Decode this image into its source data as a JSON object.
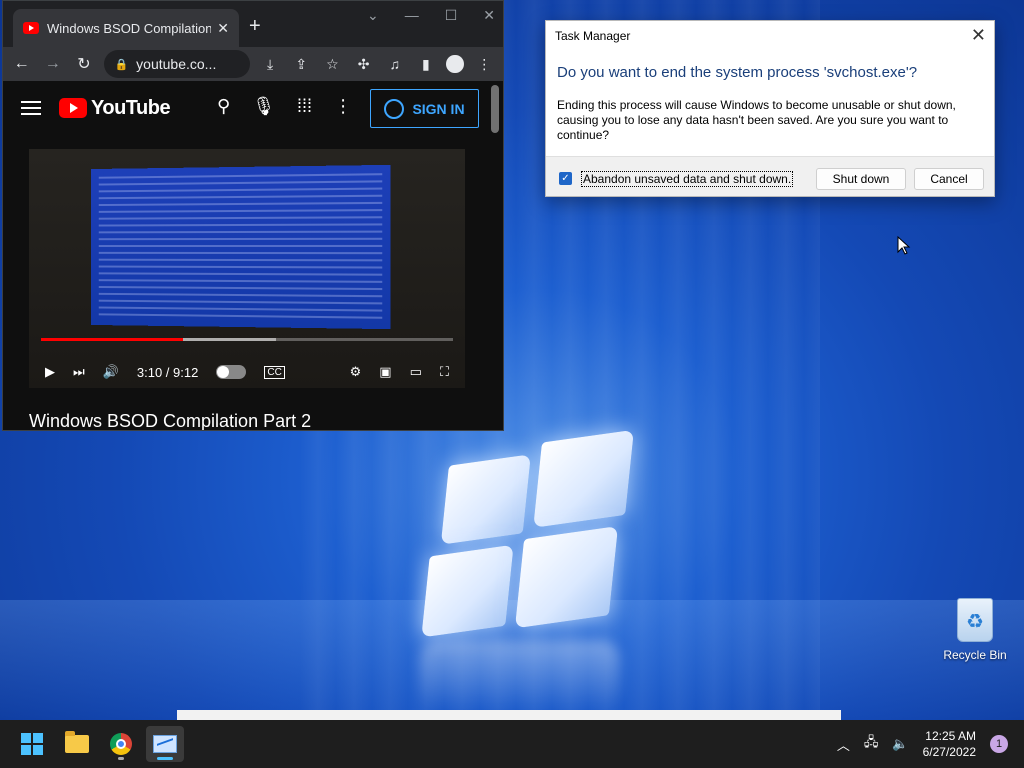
{
  "browser": {
    "tab_title": "Windows BSOD Compilation",
    "address": "youtube.co...",
    "window_controls": [
      "chevron-down-icon",
      "minimize-icon",
      "maximize-icon",
      "close-icon"
    ]
  },
  "youtube": {
    "logo_text": "YouTube",
    "sign_in_label": "SIGN IN",
    "video_time": "3:10 / 9:12",
    "video_title": "Windows BSOD Compilation Part 2",
    "progress_played_fraction": 0.345,
    "progress_buffered_fraction": 0.57
  },
  "dialog": {
    "title": "Task Manager",
    "heading": "Do you want to end the system process 'svchost.exe'?",
    "body": "Ending this process will cause Windows to become unusable or shut down, causing you to lose any data hasn't been saved. Are you sure you want to continue?",
    "checkbox_label": "Abandon unsaved data and shut down.",
    "checkbox_checked": true,
    "shutdown_label": "Shut down",
    "cancel_label": "Cancel"
  },
  "desktop": {
    "recycle_bin_label": "Recycle Bin"
  },
  "taskbar": {
    "time": "12:25 AM",
    "date": "6/27/2022",
    "notification_count": "1",
    "apps": [
      "start-icon",
      "file-explorer-icon",
      "chrome-icon",
      "task-manager-icon"
    ]
  },
  "colors": {
    "accent": "#3ea6ff",
    "youtube_red": "#ff0000",
    "dialog_heading": "#1a3f7a",
    "desktop_blue": "#1d5fd0"
  }
}
